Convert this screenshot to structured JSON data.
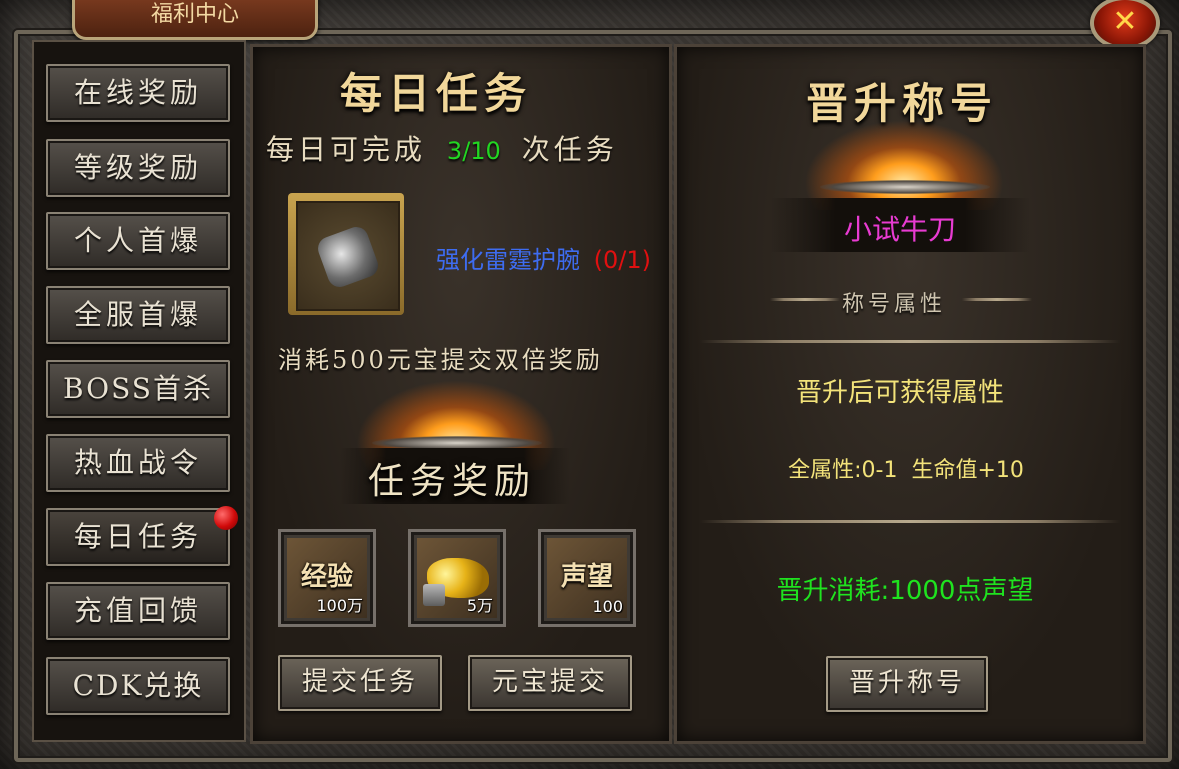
{
  "window": {
    "title": "福利中心",
    "close_symbol": "✕"
  },
  "sidebar": {
    "items": [
      {
        "label": "在线奖励"
      },
      {
        "label": "等级奖励"
      },
      {
        "label": "个人首爆"
      },
      {
        "label": "全服首爆"
      },
      {
        "label": "BOSS首杀"
      },
      {
        "label": "热血战令"
      },
      {
        "label": "每日任务",
        "active": true,
        "has_notification": true
      },
      {
        "label": "充值回馈"
      },
      {
        "label": "CDK兑换"
      }
    ]
  },
  "daily_task": {
    "title": "每日任务",
    "progress_prefix": "每日可完成",
    "progress_value": "3/10",
    "progress_suffix": "次任务",
    "task_item_icon": "gauntlet-icon",
    "task_name": "强化雷霆护腕",
    "task_progress": "(0/1)",
    "double_reward_text": "消耗500元宝提交双倍奖励",
    "reward_section_title": "任务奖励",
    "rewards": [
      {
        "label": "经验",
        "count": "100万"
      },
      {
        "label": "",
        "icon": "gold-coins-icon",
        "count": "5万"
      },
      {
        "label": "声望",
        "count": "100"
      }
    ],
    "submit_button": "提交任务",
    "yuanbao_submit_button": "元宝提交"
  },
  "promotion": {
    "title": "晋升称号",
    "current_title": "小试牛刀",
    "attributes_header": "称号属性",
    "attributes_intro": "晋升后可获得属性",
    "attributes_values": "全属性:0-1  生命值+10",
    "cost_text": "晋升消耗:1000点声望",
    "promote_button": "晋升称号"
  },
  "colors": {
    "progress_value": "#22d622",
    "task_name": "#3e6cf0",
    "task_progress": "#e01010",
    "current_title": "#e83bd2",
    "attributes": "#f3e37a",
    "cost_text": "#1fe31f"
  }
}
